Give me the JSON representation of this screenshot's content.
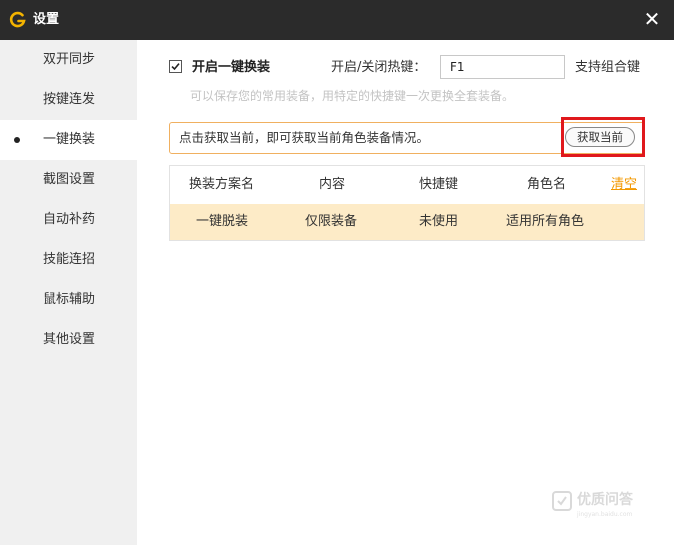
{
  "window": {
    "title": "设置",
    "close_glyph": "✕",
    "logo_icon": "g-logo-icon",
    "accent_color": "#f3b300"
  },
  "sidebar": {
    "items": [
      {
        "label": "双开同步",
        "active": false
      },
      {
        "label": "按键连发",
        "active": false
      },
      {
        "label": "一键换装",
        "active": true
      },
      {
        "label": "截图设置",
        "active": false
      },
      {
        "label": "自动补药",
        "active": false
      },
      {
        "label": "技能连招",
        "active": false
      },
      {
        "label": "鼠标辅助",
        "active": false
      },
      {
        "label": "其他设置",
        "active": false
      }
    ]
  },
  "main": {
    "enable_checkbox": {
      "label": "开启一键换装",
      "checked": true
    },
    "hotkey": {
      "label": "开启/关闭热键：",
      "value": "F1",
      "suffix": "支持组合键"
    },
    "hint": "可以保存您的常用装备，用特定的快捷键一次更换全套装备。",
    "notice": {
      "text": "点击获取当前，即可获取当前角色装备情况。",
      "button_label": "获取当前"
    },
    "table": {
      "headers": [
        "换装方案名",
        "内容",
        "快捷键",
        "角色名"
      ],
      "clear_label": "清空",
      "rows": [
        [
          "一键脱装",
          "仅限装备",
          "未使用",
          "适用所有角色"
        ]
      ]
    }
  },
  "watermark": {
    "text": "优质问答",
    "sub": "jingyan.baidu.com"
  }
}
